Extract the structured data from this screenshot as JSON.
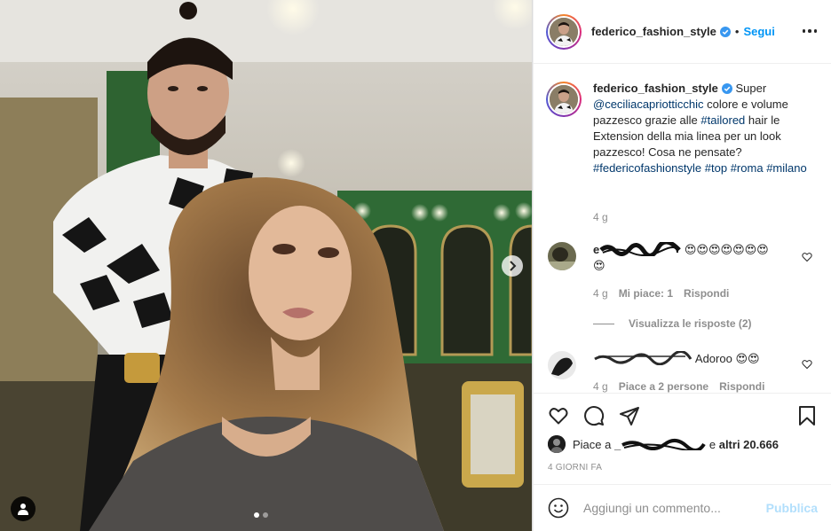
{
  "post": {
    "images_count": 2,
    "current_image": 1
  },
  "header": {
    "username": "federico_fashion_style",
    "verified": true,
    "separator": "•",
    "follow_label": "Segui"
  },
  "caption": {
    "username": "federico_fashion_style",
    "text_before": "Super",
    "mention": "@ceciliacapriotticchic",
    "text_mid": "colore e volume pazzesco grazie alle",
    "hashtag_tailored": "#tailored",
    "text_after": "hair le Extension della mia linea per un look pazzesco! Cosa ne pensate?",
    "hashtags": [
      "#federicofashionstyle",
      "#top",
      "#roma",
      "#milano"
    ],
    "time": "4 g"
  },
  "comments": [
    {
      "username_visible": "e",
      "text": "😍😍😍😍😍😍😍 😍",
      "time": "4 g",
      "likes_label": "Mi piace: 1",
      "reply_label": "Rispondi",
      "view_replies": "Visualizza le risposte (2)"
    },
    {
      "username_visible": "",
      "text": "Adoroo 😍😍",
      "time": "4 g",
      "likes_label": "Piace a 2 persone",
      "reply_label": "Rispondi"
    }
  ],
  "likes": {
    "prefix": "Piace a",
    "name_visible": "_",
    "suffix_word": "e",
    "others": "altri 20.666"
  },
  "post_date": "4 GIORNI FA",
  "add_comment": {
    "placeholder": "Aggiungi un commento...",
    "publish_label": "Pubblica"
  },
  "colors": {
    "accent_blue": "#0095f6",
    "link_dark": "#00376b",
    "meta_gray": "#8e8e8e",
    "publish_disabled": "#b2dffc",
    "verified_blue": "#3897f0"
  }
}
